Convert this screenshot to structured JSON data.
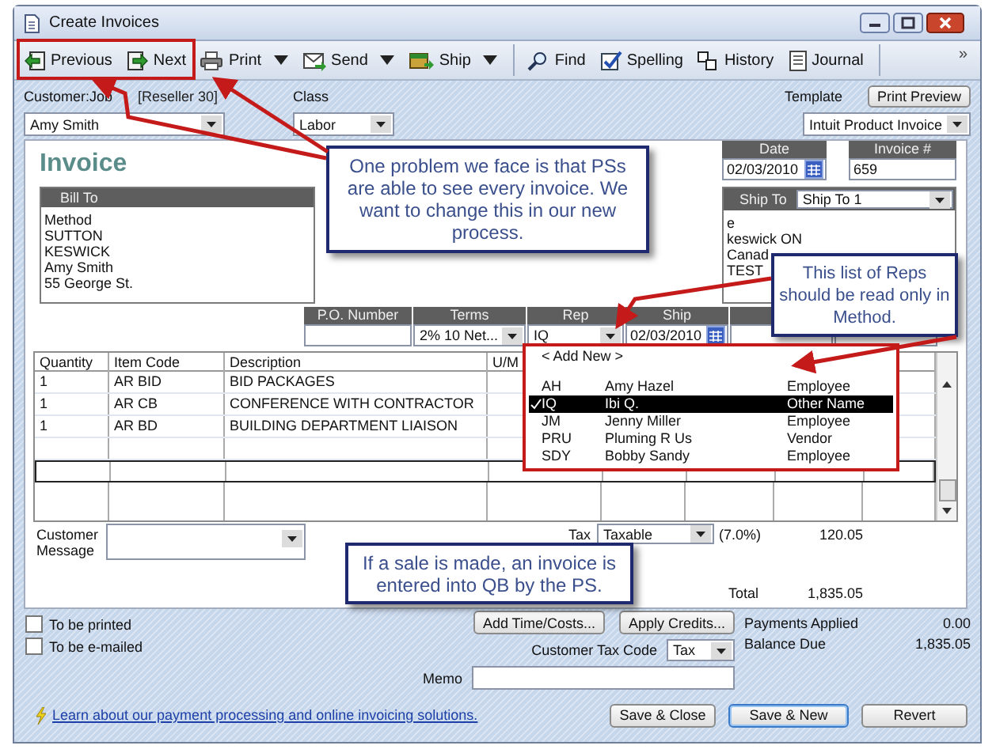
{
  "window": {
    "title": "Create Invoices"
  },
  "toolbar": {
    "items": [
      {
        "label": "Previous",
        "kind": "previous",
        "menu": false,
        "separator_before": false
      },
      {
        "label": "Next",
        "kind": "next",
        "menu": false,
        "separator_before": false
      },
      {
        "label": "Print",
        "kind": "print",
        "menu": true,
        "separator_before": false
      },
      {
        "label": "Send",
        "kind": "send",
        "menu": true,
        "separator_before": false
      },
      {
        "label": "Ship",
        "kind": "ship",
        "menu": true,
        "separator_before": false
      },
      {
        "label": "Find",
        "kind": "find",
        "menu": false,
        "separator_before": true
      },
      {
        "label": "Spelling",
        "kind": "spelling",
        "menu": false,
        "separator_before": false
      },
      {
        "label": "History",
        "kind": "history",
        "menu": false,
        "separator_before": false
      },
      {
        "label": "Journal",
        "kind": "journal",
        "menu": false,
        "separator_before": false
      }
    ],
    "overflow": "»"
  },
  "header": {
    "customer_label": "Customer:Job",
    "customer_note": "[Reseller 30]",
    "customer": "Amy Smith",
    "class_label": "Class",
    "class": "Labor",
    "template_label": "Template",
    "print_preview": "Print Preview",
    "template": "Intuit Product Invoice"
  },
  "invoice": {
    "title": "Invoice",
    "date_label": "Date",
    "date": "02/03/2010",
    "number_label": "Invoice #",
    "number": "659",
    "bill_to_label": "Bill To",
    "bill_to": [
      "Method",
      "SUTTON",
      "KESWICK",
      "Amy Smith",
      "55 George St."
    ],
    "ship_to_label": "Ship To",
    "ship_to_choice": "Ship To 1",
    "ship_to": [
      "e",
      "keswick ON",
      "Canad",
      "TEST"
    ]
  },
  "fields": [
    {
      "label": "P.O. Number",
      "kind": "text"
    },
    {
      "label": "Terms",
      "value": "2% 10 Net...",
      "kind": "combo"
    },
    {
      "label": "Rep",
      "value": "IQ",
      "kind": "combo"
    },
    {
      "label": "Ship",
      "value": "02/03/2010",
      "kind": "date"
    }
  ],
  "line_items": {
    "columns": [
      "Quantity",
      "Item Code",
      "Description",
      "U/M"
    ],
    "rows": [
      {
        "quantity": "1",
        "item_code": "AR BID",
        "description": "BID PACKAGES"
      },
      {
        "quantity": "1",
        "item_code": "AR CB",
        "description": "CONFERENCE WITH CONTRACTOR"
      },
      {
        "quantity": "1",
        "item_code": "AR BD",
        "description": "BUILDING DEPARTMENT LIAISON"
      }
    ]
  },
  "rep_dropdown": {
    "add_new": "< Add New >",
    "items": [
      {
        "code": "AH",
        "name": "Amy Hazel",
        "type": "Employee",
        "selected": false
      },
      {
        "code": "IQ",
        "name": "Ibi Q.",
        "type": "Other Name",
        "selected": true
      },
      {
        "code": "JM",
        "name": "Jenny Miller",
        "type": "Employee",
        "selected": false
      },
      {
        "code": "PRU",
        "name": "Pluming R Us",
        "type": "Vendor",
        "selected": false
      },
      {
        "code": "SDY",
        "name": "Bobby Sandy",
        "type": "Employee",
        "selected": false
      }
    ]
  },
  "customer_message_label": "Customer Message",
  "totals": {
    "tax_label": "Tax",
    "tax_code": "Taxable",
    "tax_rate": "(7.0%)",
    "tax_amount": "120.05",
    "total_label": "Total",
    "total": "1,835.05"
  },
  "options": [
    {
      "label": "To be printed",
      "checked": false
    },
    {
      "label": "To be e-mailed",
      "checked": false
    }
  ],
  "action_buttons": [
    "Add Time/Costs...",
    "Apply Credits..."
  ],
  "summary": [
    {
      "label": "Payments Applied",
      "value": "0.00"
    },
    {
      "label": "Balance Due",
      "value": "1,835.05"
    }
  ],
  "customer_tax_code": {
    "label": "Customer Tax Code",
    "value": "Tax"
  },
  "memo": {
    "label": "Memo"
  },
  "link": "Learn about our payment processing and online invoicing solutions.",
  "footer_buttons": [
    {
      "label": "Save & Close",
      "default": false
    },
    {
      "label": "Save & New",
      "default": true
    },
    {
      "label": "Revert",
      "default": false
    }
  ],
  "callouts": [
    "One problem we face is that PSs are able to see every invoice. We want to change this in our new process.",
    "This list of Reps should be read only in Method.",
    "If a sale is made, an invoice is entered into QB by the PS."
  ]
}
